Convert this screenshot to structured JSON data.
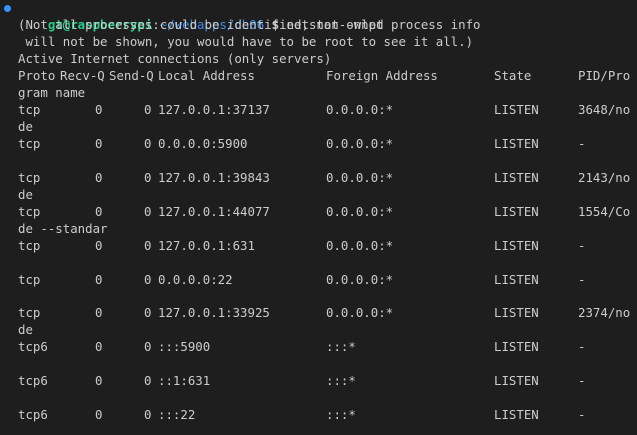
{
  "prompt": {
    "user_host": "gt@raspberrypi",
    "separator": ":",
    "path": "~/webapps/ch06",
    "symbol": "$",
    "command": "netstat -nlpt"
  },
  "messages": [
    "(Not all processes could be identified, non-owned process info",
    " will not be shown, you would have to be root to see it all.)",
    "Active Internet connections (only servers)"
  ],
  "header": {
    "proto": "Proto",
    "recvq": "Recv-Q",
    "sendq": "Send-Q",
    "local": "Local Address",
    "foreign": "Foreign Address",
    "state": "State",
    "pid": "PID/Pro",
    "wrap": "gram name"
  },
  "rows": [
    {
      "proto": "tcp",
      "recvq": "0",
      "sendq": "0",
      "local": "127.0.0.1:37137",
      "foreign": "0.0.0.0:*",
      "state": "LISTEN",
      "pid": "3648/no",
      "wrap": "de"
    },
    {
      "proto": "tcp",
      "recvq": "0",
      "sendq": "0",
      "local": "0.0.0.0:5900",
      "foreign": "0.0.0.0:*",
      "state": "LISTEN",
      "pid": "-",
      "wrap": ""
    },
    {
      "proto": "tcp",
      "recvq": "0",
      "sendq": "0",
      "local": "127.0.0.1:39843",
      "foreign": "0.0.0.0:*",
      "state": "LISTEN",
      "pid": "2143/no",
      "wrap": "de"
    },
    {
      "proto": "tcp",
      "recvq": "0",
      "sendq": "0",
      "local": "127.0.0.1:44077",
      "foreign": "0.0.0.0:*",
      "state": "LISTEN",
      "pid": "1554/Co",
      "wrap": "de --standar"
    },
    {
      "proto": "tcp",
      "recvq": "0",
      "sendq": "0",
      "local": "127.0.0.1:631",
      "foreign": "0.0.0.0:*",
      "state": "LISTEN",
      "pid": "-",
      "wrap": ""
    },
    {
      "proto": "tcp",
      "recvq": "0",
      "sendq": "0",
      "local": "0.0.0.0:22",
      "foreign": "0.0.0.0:*",
      "state": "LISTEN",
      "pid": "-",
      "wrap": ""
    },
    {
      "proto": "tcp",
      "recvq": "0",
      "sendq": "0",
      "local": "127.0.0.1:33925",
      "foreign": "0.0.0.0:*",
      "state": "LISTEN",
      "pid": "2374/no",
      "wrap": "de"
    },
    {
      "proto": "tcp6",
      "recvq": "0",
      "sendq": "0",
      "local": ":::5900",
      "foreign": ":::*",
      "state": "LISTEN",
      "pid": "-",
      "wrap": ""
    },
    {
      "proto": "tcp6",
      "recvq": "0",
      "sendq": "0",
      "local": "::1:631",
      "foreign": ":::*",
      "state": "LISTEN",
      "pid": "-",
      "wrap": ""
    },
    {
      "proto": "tcp6",
      "recvq": "0",
      "sendq": "0",
      "local": ":::22",
      "foreign": ":::*",
      "state": "LISTEN",
      "pid": "-",
      "wrap": ""
    }
  ],
  "colors": {
    "background": "#1e1e1e",
    "foreground": "#cccccc",
    "user": "#23d18b",
    "path": "#3b8eea",
    "status_dot": "#3794ff"
  }
}
